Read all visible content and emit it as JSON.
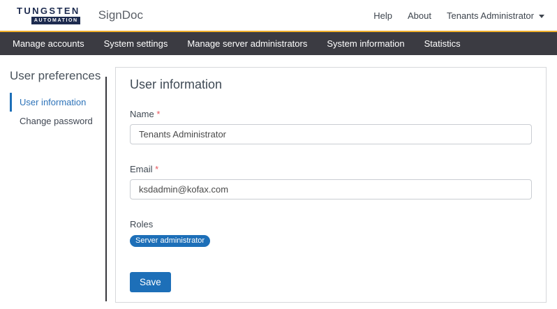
{
  "header": {
    "logo": {
      "line1": "TUNGSTEN",
      "line2": "AUTOMATION"
    },
    "app_title": "SignDoc",
    "links": [
      {
        "label": "Help"
      },
      {
        "label": "About"
      }
    ],
    "user_menu": {
      "label": "Tenants Administrator"
    }
  },
  "nav": {
    "items": [
      {
        "label": "Manage accounts"
      },
      {
        "label": "System settings"
      },
      {
        "label": "Manage server administrators"
      },
      {
        "label": "System information"
      },
      {
        "label": "Statistics"
      }
    ]
  },
  "sidebar": {
    "title": "User preferences",
    "items": [
      {
        "label": "User information",
        "active": true
      },
      {
        "label": "Change password",
        "active": false
      }
    ]
  },
  "main": {
    "title": "User information",
    "required_marker": "*",
    "fields": [
      {
        "label": "Name",
        "required": true,
        "value": "Tenants Administrator"
      },
      {
        "label": "Email",
        "required": true,
        "value": "ksdadmin@kofax.com"
      }
    ],
    "roles": {
      "label": "Roles",
      "badges": [
        "Server administrator"
      ]
    },
    "save_label": "Save"
  },
  "colors": {
    "accent_blue": "#1d6fb8",
    "accent_gold": "#f0b02c",
    "nav_background": "#3b3b42",
    "logo_navy": "#1d2b4f",
    "required_red": "#e7545c"
  }
}
